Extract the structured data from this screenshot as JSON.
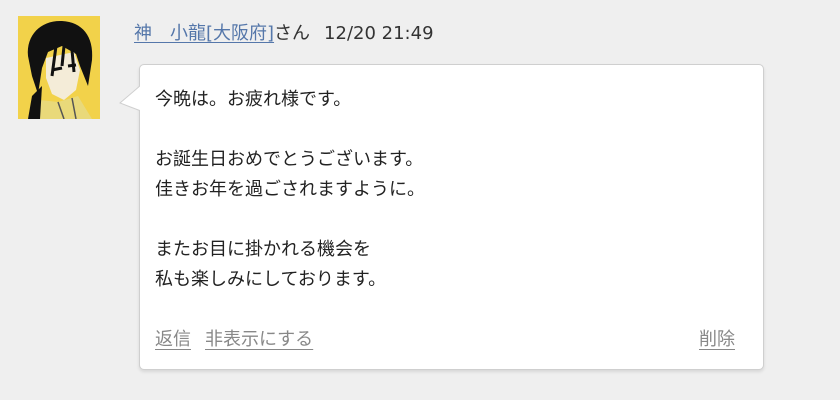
{
  "comment": {
    "user_name": "神　小龍[大阪府]",
    "user_suffix": "さん",
    "timestamp": "12/20 21:49",
    "message_lines": [
      "今晩は。お疲れ様です。",
      "",
      "お誕生日おめでとうございます。",
      "佳きお年を過ごされますように。",
      "",
      "またお目に掛かれる機会を",
      "私も楽しみにしております。"
    ],
    "actions": {
      "reply": "返信",
      "hide": "非表示にする",
      "delete": "削除"
    }
  },
  "colors": {
    "page_background": "#efefef",
    "user_link": "#5577aa",
    "action_link": "#888888",
    "avatar_background": "#f2d24a"
  }
}
